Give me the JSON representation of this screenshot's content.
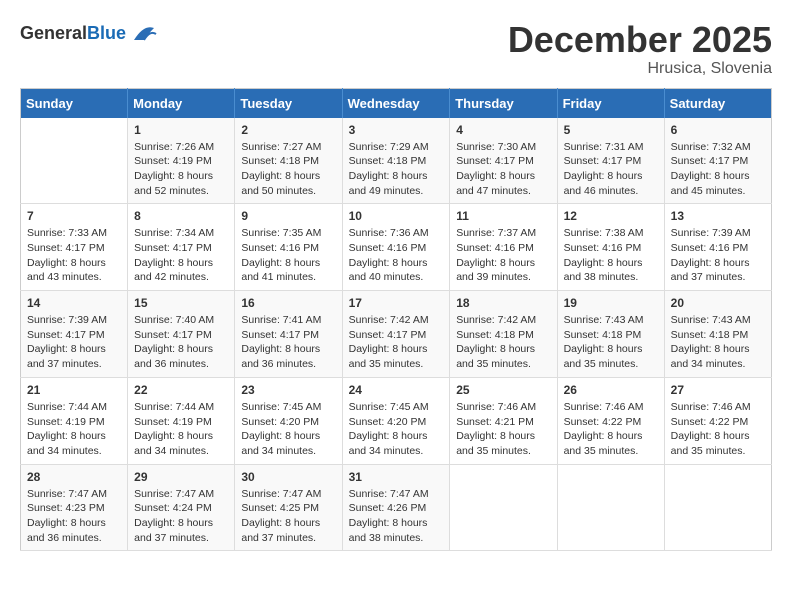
{
  "header": {
    "logo_general": "General",
    "logo_blue": "Blue",
    "month_title": "December 2025",
    "location": "Hrusica, Slovenia"
  },
  "days_of_week": [
    "Sunday",
    "Monday",
    "Tuesday",
    "Wednesday",
    "Thursday",
    "Friday",
    "Saturday"
  ],
  "weeks": [
    [
      {
        "day": "",
        "sunrise": "",
        "sunset": "",
        "daylight": ""
      },
      {
        "day": "1",
        "sunrise": "Sunrise: 7:26 AM",
        "sunset": "Sunset: 4:19 PM",
        "daylight": "Daylight: 8 hours and 52 minutes."
      },
      {
        "day": "2",
        "sunrise": "Sunrise: 7:27 AM",
        "sunset": "Sunset: 4:18 PM",
        "daylight": "Daylight: 8 hours and 50 minutes."
      },
      {
        "day": "3",
        "sunrise": "Sunrise: 7:29 AM",
        "sunset": "Sunset: 4:18 PM",
        "daylight": "Daylight: 8 hours and 49 minutes."
      },
      {
        "day": "4",
        "sunrise": "Sunrise: 7:30 AM",
        "sunset": "Sunset: 4:17 PM",
        "daylight": "Daylight: 8 hours and 47 minutes."
      },
      {
        "day": "5",
        "sunrise": "Sunrise: 7:31 AM",
        "sunset": "Sunset: 4:17 PM",
        "daylight": "Daylight: 8 hours and 46 minutes."
      },
      {
        "day": "6",
        "sunrise": "Sunrise: 7:32 AM",
        "sunset": "Sunset: 4:17 PM",
        "daylight": "Daylight: 8 hours and 45 minutes."
      }
    ],
    [
      {
        "day": "7",
        "sunrise": "Sunrise: 7:33 AM",
        "sunset": "Sunset: 4:17 PM",
        "daylight": "Daylight: 8 hours and 43 minutes."
      },
      {
        "day": "8",
        "sunrise": "Sunrise: 7:34 AM",
        "sunset": "Sunset: 4:17 PM",
        "daylight": "Daylight: 8 hours and 42 minutes."
      },
      {
        "day": "9",
        "sunrise": "Sunrise: 7:35 AM",
        "sunset": "Sunset: 4:16 PM",
        "daylight": "Daylight: 8 hours and 41 minutes."
      },
      {
        "day": "10",
        "sunrise": "Sunrise: 7:36 AM",
        "sunset": "Sunset: 4:16 PM",
        "daylight": "Daylight: 8 hours and 40 minutes."
      },
      {
        "day": "11",
        "sunrise": "Sunrise: 7:37 AM",
        "sunset": "Sunset: 4:16 PM",
        "daylight": "Daylight: 8 hours and 39 minutes."
      },
      {
        "day": "12",
        "sunrise": "Sunrise: 7:38 AM",
        "sunset": "Sunset: 4:16 PM",
        "daylight": "Daylight: 8 hours and 38 minutes."
      },
      {
        "day": "13",
        "sunrise": "Sunrise: 7:39 AM",
        "sunset": "Sunset: 4:16 PM",
        "daylight": "Daylight: 8 hours and 37 minutes."
      }
    ],
    [
      {
        "day": "14",
        "sunrise": "Sunrise: 7:39 AM",
        "sunset": "Sunset: 4:17 PM",
        "daylight": "Daylight: 8 hours and 37 minutes."
      },
      {
        "day": "15",
        "sunrise": "Sunrise: 7:40 AM",
        "sunset": "Sunset: 4:17 PM",
        "daylight": "Daylight: 8 hours and 36 minutes."
      },
      {
        "day": "16",
        "sunrise": "Sunrise: 7:41 AM",
        "sunset": "Sunset: 4:17 PM",
        "daylight": "Daylight: 8 hours and 36 minutes."
      },
      {
        "day": "17",
        "sunrise": "Sunrise: 7:42 AM",
        "sunset": "Sunset: 4:17 PM",
        "daylight": "Daylight: 8 hours and 35 minutes."
      },
      {
        "day": "18",
        "sunrise": "Sunrise: 7:42 AM",
        "sunset": "Sunset: 4:18 PM",
        "daylight": "Daylight: 8 hours and 35 minutes."
      },
      {
        "day": "19",
        "sunrise": "Sunrise: 7:43 AM",
        "sunset": "Sunset: 4:18 PM",
        "daylight": "Daylight: 8 hours and 35 minutes."
      },
      {
        "day": "20",
        "sunrise": "Sunrise: 7:43 AM",
        "sunset": "Sunset: 4:18 PM",
        "daylight": "Daylight: 8 hours and 34 minutes."
      }
    ],
    [
      {
        "day": "21",
        "sunrise": "Sunrise: 7:44 AM",
        "sunset": "Sunset: 4:19 PM",
        "daylight": "Daylight: 8 hours and 34 minutes."
      },
      {
        "day": "22",
        "sunrise": "Sunrise: 7:44 AM",
        "sunset": "Sunset: 4:19 PM",
        "daylight": "Daylight: 8 hours and 34 minutes."
      },
      {
        "day": "23",
        "sunrise": "Sunrise: 7:45 AM",
        "sunset": "Sunset: 4:20 PM",
        "daylight": "Daylight: 8 hours and 34 minutes."
      },
      {
        "day": "24",
        "sunrise": "Sunrise: 7:45 AM",
        "sunset": "Sunset: 4:20 PM",
        "daylight": "Daylight: 8 hours and 34 minutes."
      },
      {
        "day": "25",
        "sunrise": "Sunrise: 7:46 AM",
        "sunset": "Sunset: 4:21 PM",
        "daylight": "Daylight: 8 hours and 35 minutes."
      },
      {
        "day": "26",
        "sunrise": "Sunrise: 7:46 AM",
        "sunset": "Sunset: 4:22 PM",
        "daylight": "Daylight: 8 hours and 35 minutes."
      },
      {
        "day": "27",
        "sunrise": "Sunrise: 7:46 AM",
        "sunset": "Sunset: 4:22 PM",
        "daylight": "Daylight: 8 hours and 35 minutes."
      }
    ],
    [
      {
        "day": "28",
        "sunrise": "Sunrise: 7:47 AM",
        "sunset": "Sunset: 4:23 PM",
        "daylight": "Daylight: 8 hours and 36 minutes."
      },
      {
        "day": "29",
        "sunrise": "Sunrise: 7:47 AM",
        "sunset": "Sunset: 4:24 PM",
        "daylight": "Daylight: 8 hours and 37 minutes."
      },
      {
        "day": "30",
        "sunrise": "Sunrise: 7:47 AM",
        "sunset": "Sunset: 4:25 PM",
        "daylight": "Daylight: 8 hours and 37 minutes."
      },
      {
        "day": "31",
        "sunrise": "Sunrise: 7:47 AM",
        "sunset": "Sunset: 4:26 PM",
        "daylight": "Daylight: 8 hours and 38 minutes."
      },
      {
        "day": "",
        "sunrise": "",
        "sunset": "",
        "daylight": ""
      },
      {
        "day": "",
        "sunrise": "",
        "sunset": "",
        "daylight": ""
      },
      {
        "day": "",
        "sunrise": "",
        "sunset": "",
        "daylight": ""
      }
    ]
  ]
}
